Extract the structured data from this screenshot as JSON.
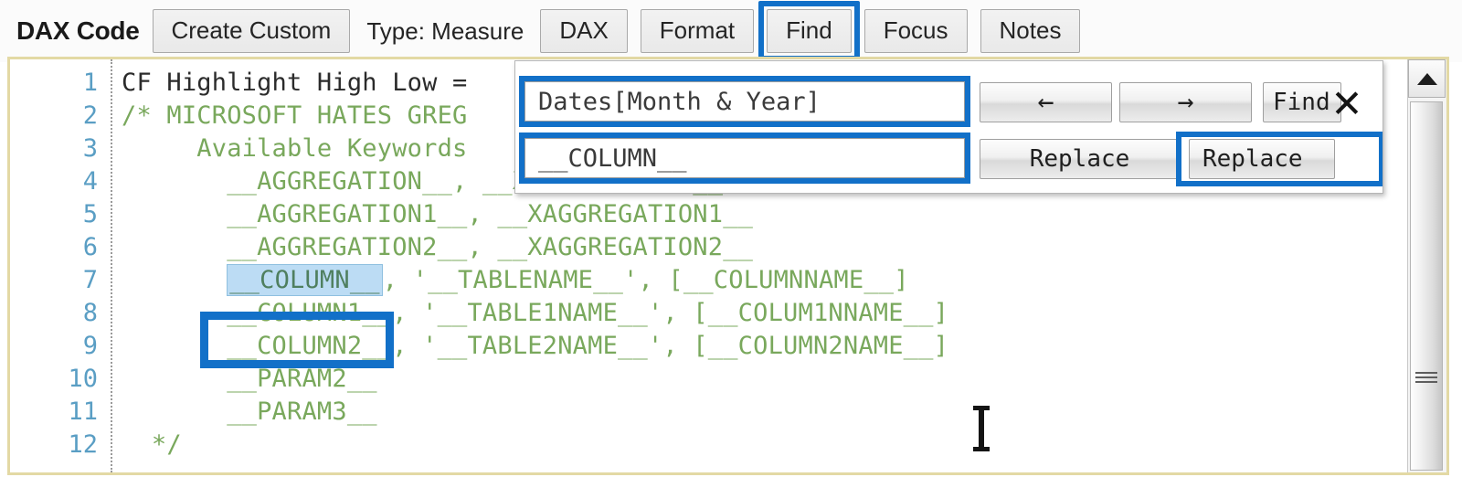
{
  "toolbar": {
    "title": "DAX Code",
    "create_custom_label": "Create Custom",
    "type_label": "Type:  Measure",
    "dax_label": "DAX",
    "format_label": "Format",
    "find_label": "Find",
    "focus_label": "Focus",
    "notes_label": "Notes",
    "highlight_color": "#1270c8"
  },
  "editor": {
    "border_color": "#e3d9a4",
    "gutter_numbers": [
      "1",
      "2",
      "3",
      "4",
      "5",
      "6",
      "7",
      "8",
      "9",
      "10",
      "11",
      "12"
    ],
    "selected_token": "__COLUMN__",
    "lines": [
      {
        "n": "1",
        "type": "plain",
        "text": "CF Highlight High Low ="
      },
      {
        "n": "2",
        "type": "comment",
        "text": "/* MICROSOFT HATES GREG"
      },
      {
        "n": "3",
        "type": "comment",
        "text": "     Available Keywords"
      },
      {
        "n": "4",
        "type": "comment",
        "text": "       __AGGREGATION__, __XAGGREGATION__"
      },
      {
        "n": "5",
        "type": "comment",
        "text": "       __AGGREGATION1__, __XAGGREGATION1__"
      },
      {
        "n": "6",
        "type": "comment",
        "text": "       __AGGREGATION2__, __XAGGREGATION2__"
      },
      {
        "n": "7",
        "type": "comment-split",
        "before": "       ",
        "token": "__COLUMN__",
        "after": ", '__TABLENAME__', [__COLUMNNAME__]"
      },
      {
        "n": "8",
        "type": "comment",
        "text": "       __COLUMN1__, '__TABLE1NAME__', [__COLUM1NNAME__]"
      },
      {
        "n": "9",
        "type": "comment",
        "text": "       __COLUMN2__, '__TABLE2NAME__', [__COLUMN2NAME__]"
      },
      {
        "n": "10",
        "type": "comment",
        "text": "       __PARAM2__"
      },
      {
        "n": "11",
        "type": "comment",
        "text": "       __PARAM3__"
      },
      {
        "n": "12",
        "type": "comment",
        "text": "  */"
      }
    ],
    "colors": {
      "plain": "#2b2b2b",
      "comment": "#79a85c",
      "line_number": "#5a9ec4",
      "selection_bg": "#bcdcf4"
    }
  },
  "find_panel": {
    "find_value": "Dates[Month & Year]",
    "replace_value": "__COLUMN__",
    "prev_icon": "arrow-left-icon",
    "next_icon": "arrow-right-icon",
    "prev_glyph": "←",
    "next_glyph": "→",
    "find_button_label": "Find",
    "replace_button_label": "Replace",
    "replace_all_button_label": "Replace",
    "close_glyph": "✕",
    "highlight_color": "#1270c8"
  },
  "scrollbar": {
    "up_arrow_icon": "triangle-up-icon",
    "grip_icon": "grip-lines-icon"
  }
}
